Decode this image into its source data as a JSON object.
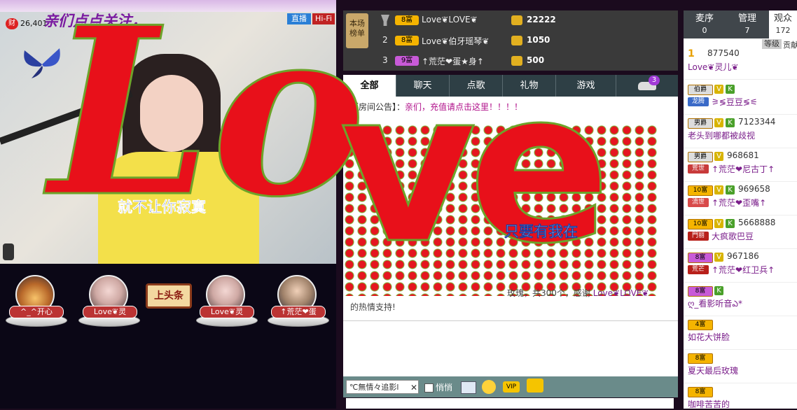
{
  "stream": {
    "wealth_count": "26,401",
    "follow_banner": "亲们点点关注，",
    "live_badge": "直播",
    "hifi_badge": "Hi-Fi",
    "caption_left": "就不让你寂寞",
    "caption_right": "只要有我在",
    "headline_button": "上头条",
    "guests": [
      {
        "label": "^_^开心"
      },
      {
        "label": "Love❦灵"
      },
      {
        "label": "Love❦灵"
      },
      {
        "label": "↑荒茫❤蛋"
      }
    ]
  },
  "ranking": {
    "label": "本场榜单",
    "rows": [
      {
        "rank": "",
        "badge": "8富",
        "name": "Love❦LOVE❦",
        "value": "22222"
      },
      {
        "rank": "2",
        "badge": "8富",
        "name": "Love❦伯牙瑶琴❦",
        "value": "1050"
      },
      {
        "rank": "3",
        "badge": "9富",
        "name": "↑荒茫❤蛋★身↑",
        "value": "500"
      }
    ]
  },
  "chat_tabs": [
    "全部",
    "聊天",
    "点歌",
    "礼物",
    "游戏"
  ],
  "chat_tab_badge": "3",
  "announcement": {
    "prefix": "【房间公告】：",
    "text": "亲们，充值请点击这里！！！！"
  },
  "gift_message": {
    "text": "玫瑰，共300个，感谢",
    "sender": "Love❦LOVE❦",
    "suffix": "的热情支持!"
  },
  "big_word_left": "Lo",
  "big_word_right": "ve",
  "input": {
    "recipient": "℃無情々追影l",
    "whisper": "悄悄"
  },
  "right_tabs": [
    {
      "label": "麦序",
      "count": "0"
    },
    {
      "label": "管理",
      "count": "7"
    },
    {
      "label": "观众",
      "count": "172"
    }
  ],
  "level_label": "等级",
  "contrib_label": "贡献",
  "users": [
    {
      "badge": "1",
      "id": "877540",
      "name": "Love❦灵儿❦",
      "tag": ""
    },
    {
      "badge": "伯爵",
      "id": "",
      "name": "⚞≶豆豆≶⚟",
      "tag": "龙腾"
    },
    {
      "badge": "男爵",
      "id": "7123344",
      "name": "老头到哪都被歧视",
      "tag": ""
    },
    {
      "badge": "男爵",
      "id": "968681",
      "name": "↑荒茫❤尼古丁↑",
      "tag": "荒世"
    },
    {
      "badge": "10富",
      "id": "969658",
      "name": "↑荒茫❤歪嘴↑",
      "tag": "流世"
    },
    {
      "badge": "10富",
      "id": "5668888",
      "name": "大疯歌巴豆",
      "tag": "門丽"
    },
    {
      "badge": "8富",
      "id": "967186",
      "name": "↑荒茫❤红卫兵↑",
      "tag": "荒芒"
    },
    {
      "badge": "8富",
      "id": "",
      "name": "ღ_看影听音ఎ*",
      "tag": ""
    },
    {
      "badge": "4富",
      "id": "",
      "name": "如花大饼脸",
      "tag": ""
    },
    {
      "badge": "8富",
      "id": "",
      "name": "夏天最后玫瑰",
      "tag": ""
    },
    {
      "badge": "8富",
      "id": "",
      "name": "咖啡苦苦的",
      "tag": ""
    }
  ]
}
